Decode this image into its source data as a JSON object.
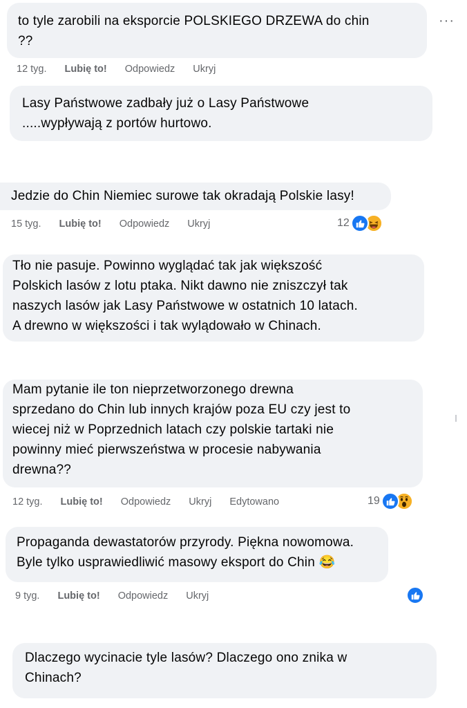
{
  "colors": {
    "bubble_bg": "#f0f2f5",
    "meta_text": "#65676b",
    "like_blue": "#1877f2",
    "emoji_yellow": "#f7b125"
  },
  "more_menu_label": "···",
  "comments": [
    {
      "text": "to tyle zarobili na eksporcie POLSKIEGO DRZEWA do chin\n??",
      "meta": {
        "time": "12 tyg.",
        "like": "Lubię to!",
        "reply": "Odpowiedz",
        "hide": "Ukryj"
      }
    },
    {
      "text": "Lasy Państwowe zadbały już o Lasy Państwowe\n.....wypływają z portów hurtowo."
    },
    {
      "text": "Jedzie do Chin Niemiec surowe tak okradają Polskie lasy!",
      "meta": {
        "time": "15 tyg.",
        "like": "Lubię to!",
        "reply": "Odpowiedz",
        "hide": "Ukryj"
      },
      "reactions": {
        "count": "12",
        "icons": [
          "like-icon",
          "laughing-emoji-icon"
        ]
      }
    },
    {
      "text": "Tło nie pasuje. Powinno wyglądać tak jak większość\nPolskich lasów z lotu ptaka. Nikt dawno nie zniszczył tak\nnaszych lasów jak Lasy Państwowe w ostatnich 10 latach.\nA drewno w większości i tak wylądowało w Chinach."
    },
    {
      "text": "Mam pytanie ile ton nieprzetworzonego drewna\nsprzedano do Chin lub innych krajów poza EU czy jest to\nwiecej niż w Poprzednich latach czy polskie tartaki nie\npowinny mieć pierwszeństwa w procesie nabywania\ndrewna??",
      "meta": {
        "time": "12 tyg.",
        "like": "Lubię to!",
        "reply": "Odpowiedz",
        "hide": "Ukryj",
        "edited": "Edytowano"
      },
      "reactions": {
        "count": "19",
        "icons": [
          "like-icon",
          "wow-emoji-icon"
        ]
      }
    },
    {
      "text": "Propaganda dewastatorów przyrody. Piękna nowomowa.\nByle tylko usprawiedliwić masowy eksport do Chin 😂",
      "meta": {
        "time": "9 tyg.",
        "like": "Lubię to!",
        "reply": "Odpowiedz",
        "hide": "Ukryj"
      },
      "reactions": {
        "count": "",
        "icons": [
          "like-icon"
        ]
      }
    },
    {
      "text": "Dlaczego wycinacie tyle lasów? Dlaczego ono znika w\nChinach?"
    }
  ]
}
